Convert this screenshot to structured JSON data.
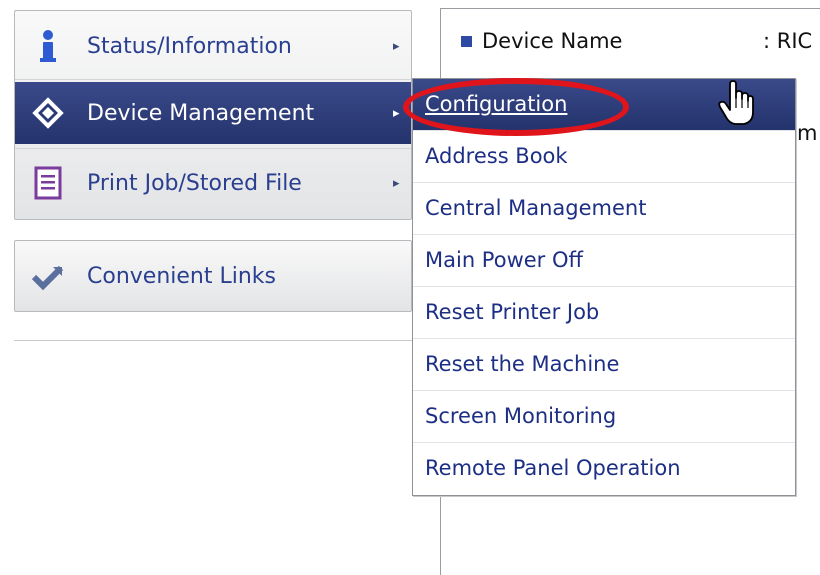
{
  "menu": {
    "items": [
      {
        "label": "Status/Information",
        "icon": "info-icon",
        "arrow": "▸"
      },
      {
        "label": "Device Management",
        "icon": "diamond-icon",
        "arrow": "▸",
        "active": true
      },
      {
        "label": "Print Job/Stored File",
        "icon": "document-icon",
        "arrow": "▸"
      }
    ],
    "links": {
      "label": "Convenient Links",
      "icon": "check-arrow-icon"
    }
  },
  "content": {
    "device_name_label": "Device Name",
    "device_name_value": ": RIC",
    "partial_text": "m"
  },
  "dropdown": {
    "items": [
      {
        "label": "Configuration",
        "highlighted": true
      },
      {
        "label": "Address Book"
      },
      {
        "label": "Central Management"
      },
      {
        "label": "Main Power Off"
      },
      {
        "label": "Reset Printer Job"
      },
      {
        "label": "Reset the Machine"
      },
      {
        "label": "Screen Monitoring"
      },
      {
        "label": "Remote Panel Operation"
      }
    ]
  },
  "colors": {
    "accent": "#2a3f8f",
    "active_bg": "#2f3e7c",
    "highlight_circle": "#e0141b"
  }
}
